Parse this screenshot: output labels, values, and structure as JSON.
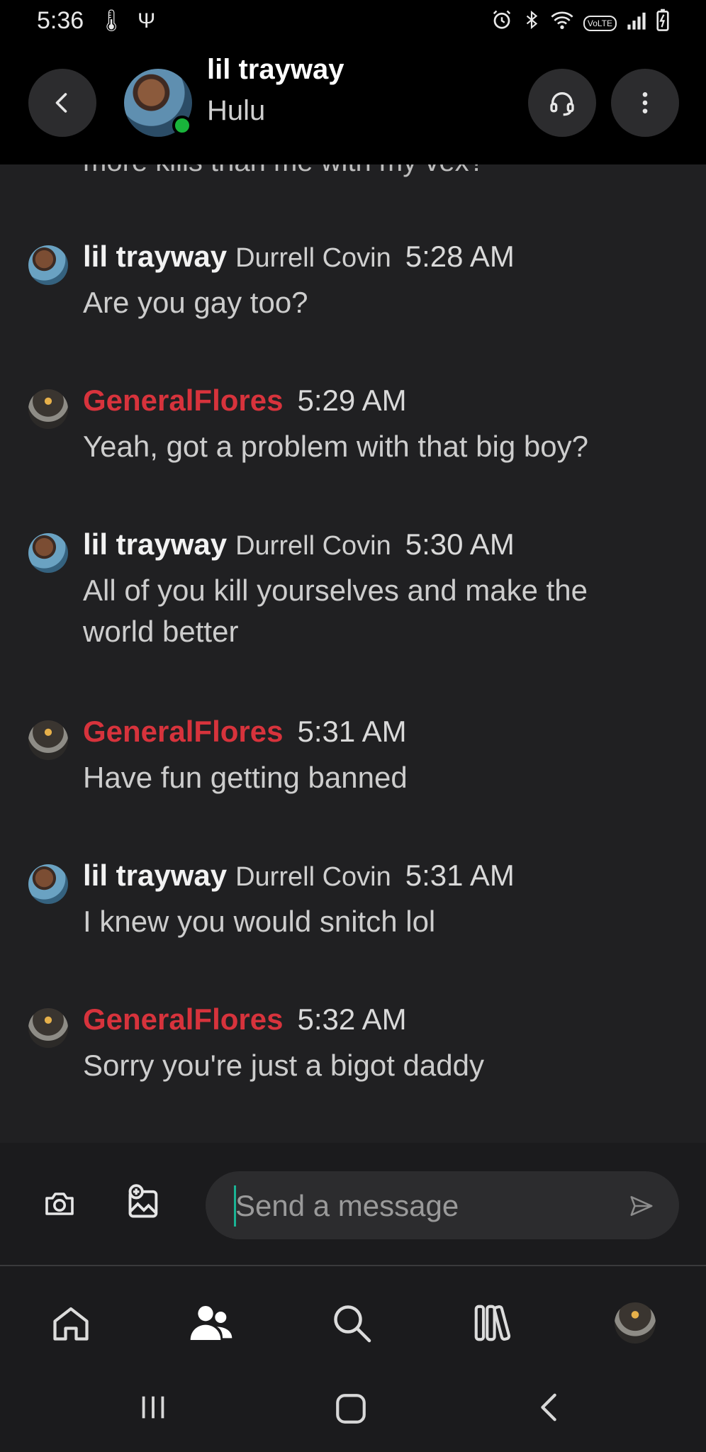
{
  "status_bar": {
    "time": "5:36",
    "left_icons": [
      "thermometer-icon",
      "fork-icon"
    ],
    "right_icons": [
      "alarm-icon",
      "bluetooth-icon",
      "wifi-icon",
      "volte-icon",
      "signal-icon",
      "battery-charging-icon"
    ],
    "volte_label": "VoLTE"
  },
  "header": {
    "name": "lil trayway",
    "subtitle": "Hulu",
    "online_color": "#19b43b"
  },
  "messages": {
    "cut_off_text": "more kills than me with my vex?",
    "items": [
      {
        "sender": "lil trayway",
        "real_name": "Durrell Covin",
        "time": "5:28 AM",
        "text": "Are you gay too?"
      },
      {
        "sender": "GeneralFlores",
        "real_name": "",
        "time": "5:29 AM",
        "text": "Yeah, got a problem with that big boy?"
      },
      {
        "sender": "lil trayway",
        "real_name": "Durrell Covin",
        "time": "5:30 AM",
        "text": "All of you kill yourselves and make the world better"
      },
      {
        "sender": "GeneralFlores",
        "real_name": "",
        "time": "5:31 AM",
        "text": "Have fun getting banned"
      },
      {
        "sender": "lil trayway",
        "real_name": "Durrell Covin",
        "time": "5:31 AM",
        "text": "I knew you would snitch lol"
      },
      {
        "sender": "GeneralFlores",
        "real_name": "",
        "time": "5:32 AM",
        "text": "Sorry you're just a bigot daddy"
      }
    ]
  },
  "composer": {
    "placeholder": "Send a message",
    "value": ""
  },
  "bottom_nav": {
    "items": [
      "home-icon",
      "people-icon",
      "search-icon",
      "library-icon",
      "profile-avatar"
    ]
  },
  "colors": {
    "background": "#202022",
    "header": "#000000",
    "accent_red": "#d7333c",
    "caret": "#1ab394"
  }
}
